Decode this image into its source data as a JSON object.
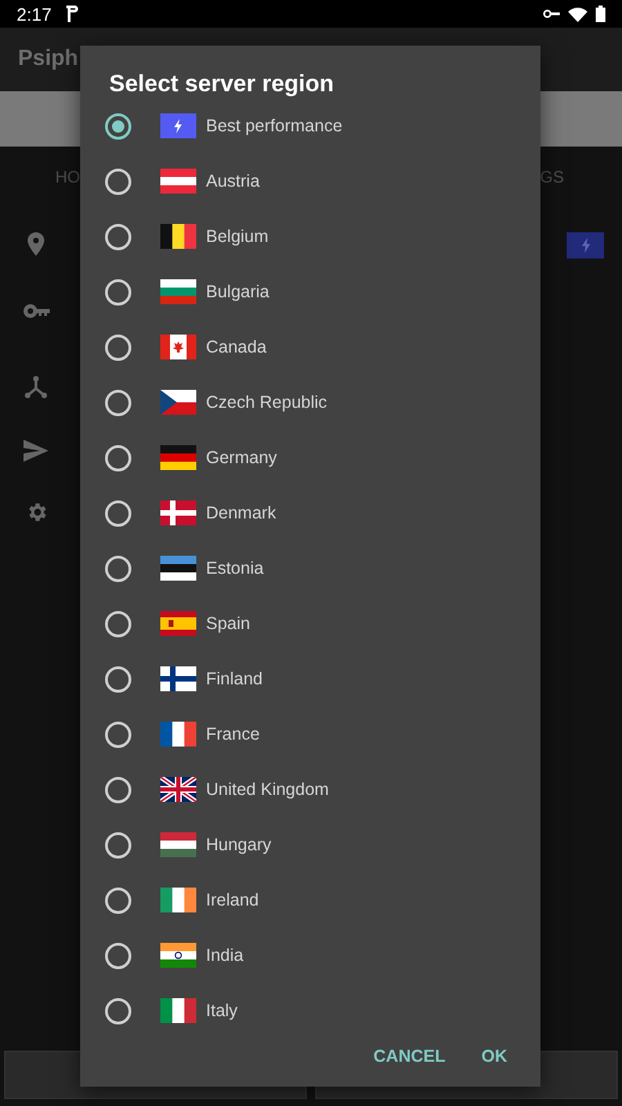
{
  "status_bar": {
    "time": "2:17"
  },
  "app_bar": {
    "title": "Psiph"
  },
  "tabs": [
    {
      "label": "HO"
    },
    {
      "label": "GS"
    }
  ],
  "dialog": {
    "title": "Select server region",
    "options": [
      {
        "label": "Best performance",
        "selected": true
      },
      {
        "label": "Austria",
        "selected": false
      },
      {
        "label": "Belgium",
        "selected": false
      },
      {
        "label": "Bulgaria",
        "selected": false
      },
      {
        "label": "Canada",
        "selected": false
      },
      {
        "label": "Czech Republic",
        "selected": false
      },
      {
        "label": "Germany",
        "selected": false
      },
      {
        "label": "Denmark",
        "selected": false
      },
      {
        "label": "Estonia",
        "selected": false
      },
      {
        "label": "Spain",
        "selected": false
      },
      {
        "label": "Finland",
        "selected": false
      },
      {
        "label": "France",
        "selected": false
      },
      {
        "label": "United Kingdom",
        "selected": false
      },
      {
        "label": "Hungary",
        "selected": false
      },
      {
        "label": "Ireland",
        "selected": false
      },
      {
        "label": "India",
        "selected": false
      },
      {
        "label": "Italy",
        "selected": false
      }
    ],
    "buttons": [
      "CANCEL",
      "OK"
    ]
  }
}
